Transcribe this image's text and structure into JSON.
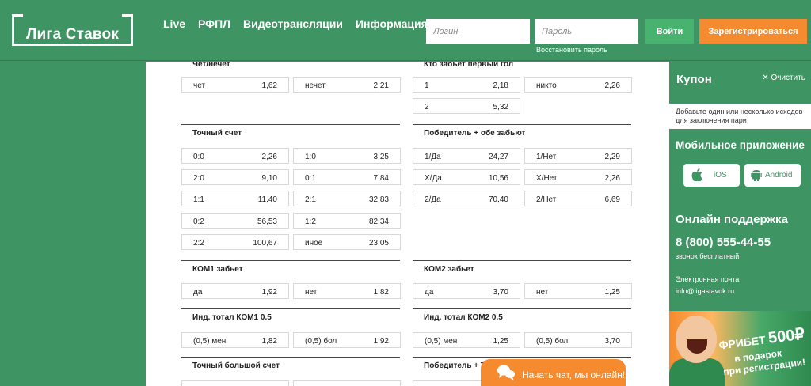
{
  "header": {
    "logo_text": "Лига Ставок",
    "nav": [
      "Live",
      "РФПЛ",
      "Видеотрансляции",
      "Информация"
    ],
    "login_placeholder": "Логин",
    "password_placeholder": "Пароль",
    "restore_password": "Восстановить пароль",
    "login_button": "Войти",
    "register_button": "Зарегистрироваться"
  },
  "blocks": {
    "odd_even": {
      "title": "Чет/нечет",
      "cells": [
        {
          "k": "чет",
          "v": "1,62"
        },
        {
          "k": "нечет",
          "v": "2,21"
        }
      ]
    },
    "first_goal": {
      "title": "Кто забьет первый гол",
      "cells": [
        {
          "k": "1",
          "v": "2,18"
        },
        {
          "k": "никто",
          "v": "2,26"
        },
        {
          "k": "2",
          "v": "5,32"
        }
      ]
    },
    "exact_score": {
      "title": "Точный счет",
      "cells": [
        {
          "k": "0:0",
          "v": "2,26"
        },
        {
          "k": "1:0",
          "v": "3,25"
        },
        {
          "k": "2:0",
          "v": "9,10"
        },
        {
          "k": "0:1",
          "v": "7,84"
        },
        {
          "k": "1:1",
          "v": "11,40"
        },
        {
          "k": "2:1",
          "v": "32,83"
        },
        {
          "k": "0:2",
          "v": "56,53"
        },
        {
          "k": "1:2",
          "v": "82,34"
        },
        {
          "k": "2:2",
          "v": "100,67"
        },
        {
          "k": "иное",
          "v": "23,05"
        }
      ]
    },
    "winner_both": {
      "title": "Победитель + обе забьют",
      "cells": [
        {
          "k": "1/Да",
          "v": "24,27"
        },
        {
          "k": "1/Нет",
          "v": "2,29"
        },
        {
          "k": "X/Да",
          "v": "10,56"
        },
        {
          "k": "X/Нет",
          "v": "2,26"
        },
        {
          "k": "2/Да",
          "v": "70,40"
        },
        {
          "k": "2/Нет",
          "v": "6,69"
        }
      ]
    },
    "team1_scores": {
      "title": "КОМ1 забьет",
      "cells": [
        {
          "k": "да",
          "v": "1,92"
        },
        {
          "k": "нет",
          "v": "1,82"
        }
      ]
    },
    "team2_scores": {
      "title": "КОМ2 забьет",
      "cells": [
        {
          "k": "да",
          "v": "3,70"
        },
        {
          "k": "нет",
          "v": "1,25"
        }
      ]
    },
    "team1_total": {
      "title": "Инд. тотал КОМ1 0.5",
      "cells": [
        {
          "k": "(0,5) мен",
          "v": "1,82"
        },
        {
          "k": "(0,5) бол",
          "v": "1,92"
        }
      ]
    },
    "team2_total": {
      "title": "Инд. тотал КОМ2 0.5",
      "cells": [
        {
          "k": "(0,5) мен",
          "v": "1,25"
        },
        {
          "k": "(0,5) бол",
          "v": "3,70"
        }
      ]
    },
    "exact_big_score": {
      "title": "Точный большой счет"
    },
    "winner_total": {
      "title": "Победитель + Тота"
    }
  },
  "sidebar": {
    "coupon_title": "Купон",
    "coupon_clear": "Очистить",
    "coupon_hint": "Добавьте один или несколько исходов для заключения пари",
    "mobile_title": "Мобильное приложение",
    "ios": "iOS",
    "android": "Android",
    "support_title": "Онлайн поддержка",
    "phone": "8 (800) 555-44-55",
    "phone_note": "звонок бесплатный",
    "email_label": "Электронная почта",
    "email": "info@ligastavok.ru",
    "promo_line1": "ФРИБЕТ",
    "promo_amount": "500₽",
    "promo_line2": "в подарок",
    "promo_line3": "при регистрации!"
  },
  "chat": {
    "label": "Начать чат, мы онлайн!"
  },
  "colors": {
    "brand_green": "#3f9463",
    "accent_orange": "#f58a2e",
    "button_green": "#47b36f"
  }
}
